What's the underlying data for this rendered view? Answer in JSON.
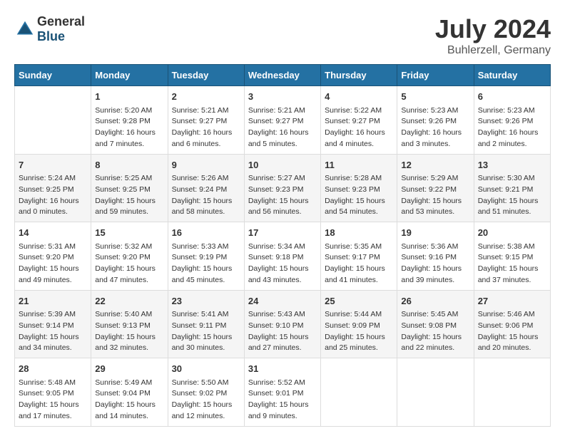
{
  "header": {
    "logo_general": "General",
    "logo_blue": "Blue",
    "month": "July 2024",
    "location": "Buhlerzell, Germany"
  },
  "weekdays": [
    "Sunday",
    "Monday",
    "Tuesday",
    "Wednesday",
    "Thursday",
    "Friday",
    "Saturday"
  ],
  "weeks": [
    [
      {
        "day": "",
        "content": ""
      },
      {
        "day": "1",
        "content": "Sunrise: 5:20 AM\nSunset: 9:28 PM\nDaylight: 16 hours\nand 7 minutes."
      },
      {
        "day": "2",
        "content": "Sunrise: 5:21 AM\nSunset: 9:27 PM\nDaylight: 16 hours\nand 6 minutes."
      },
      {
        "day": "3",
        "content": "Sunrise: 5:21 AM\nSunset: 9:27 PM\nDaylight: 16 hours\nand 5 minutes."
      },
      {
        "day": "4",
        "content": "Sunrise: 5:22 AM\nSunset: 9:27 PM\nDaylight: 16 hours\nand 4 minutes."
      },
      {
        "day": "5",
        "content": "Sunrise: 5:23 AM\nSunset: 9:26 PM\nDaylight: 16 hours\nand 3 minutes."
      },
      {
        "day": "6",
        "content": "Sunrise: 5:23 AM\nSunset: 9:26 PM\nDaylight: 16 hours\nand 2 minutes."
      }
    ],
    [
      {
        "day": "7",
        "content": "Sunrise: 5:24 AM\nSunset: 9:25 PM\nDaylight: 16 hours\nand 0 minutes."
      },
      {
        "day": "8",
        "content": "Sunrise: 5:25 AM\nSunset: 9:25 PM\nDaylight: 15 hours\nand 59 minutes."
      },
      {
        "day": "9",
        "content": "Sunrise: 5:26 AM\nSunset: 9:24 PM\nDaylight: 15 hours\nand 58 minutes."
      },
      {
        "day": "10",
        "content": "Sunrise: 5:27 AM\nSunset: 9:23 PM\nDaylight: 15 hours\nand 56 minutes."
      },
      {
        "day": "11",
        "content": "Sunrise: 5:28 AM\nSunset: 9:23 PM\nDaylight: 15 hours\nand 54 minutes."
      },
      {
        "day": "12",
        "content": "Sunrise: 5:29 AM\nSunset: 9:22 PM\nDaylight: 15 hours\nand 53 minutes."
      },
      {
        "day": "13",
        "content": "Sunrise: 5:30 AM\nSunset: 9:21 PM\nDaylight: 15 hours\nand 51 minutes."
      }
    ],
    [
      {
        "day": "14",
        "content": "Sunrise: 5:31 AM\nSunset: 9:20 PM\nDaylight: 15 hours\nand 49 minutes."
      },
      {
        "day": "15",
        "content": "Sunrise: 5:32 AM\nSunset: 9:20 PM\nDaylight: 15 hours\nand 47 minutes."
      },
      {
        "day": "16",
        "content": "Sunrise: 5:33 AM\nSunset: 9:19 PM\nDaylight: 15 hours\nand 45 minutes."
      },
      {
        "day": "17",
        "content": "Sunrise: 5:34 AM\nSunset: 9:18 PM\nDaylight: 15 hours\nand 43 minutes."
      },
      {
        "day": "18",
        "content": "Sunrise: 5:35 AM\nSunset: 9:17 PM\nDaylight: 15 hours\nand 41 minutes."
      },
      {
        "day": "19",
        "content": "Sunrise: 5:36 AM\nSunset: 9:16 PM\nDaylight: 15 hours\nand 39 minutes."
      },
      {
        "day": "20",
        "content": "Sunrise: 5:38 AM\nSunset: 9:15 PM\nDaylight: 15 hours\nand 37 minutes."
      }
    ],
    [
      {
        "day": "21",
        "content": "Sunrise: 5:39 AM\nSunset: 9:14 PM\nDaylight: 15 hours\nand 34 minutes."
      },
      {
        "day": "22",
        "content": "Sunrise: 5:40 AM\nSunset: 9:13 PM\nDaylight: 15 hours\nand 32 minutes."
      },
      {
        "day": "23",
        "content": "Sunrise: 5:41 AM\nSunset: 9:11 PM\nDaylight: 15 hours\nand 30 minutes."
      },
      {
        "day": "24",
        "content": "Sunrise: 5:43 AM\nSunset: 9:10 PM\nDaylight: 15 hours\nand 27 minutes."
      },
      {
        "day": "25",
        "content": "Sunrise: 5:44 AM\nSunset: 9:09 PM\nDaylight: 15 hours\nand 25 minutes."
      },
      {
        "day": "26",
        "content": "Sunrise: 5:45 AM\nSunset: 9:08 PM\nDaylight: 15 hours\nand 22 minutes."
      },
      {
        "day": "27",
        "content": "Sunrise: 5:46 AM\nSunset: 9:06 PM\nDaylight: 15 hours\nand 20 minutes."
      }
    ],
    [
      {
        "day": "28",
        "content": "Sunrise: 5:48 AM\nSunset: 9:05 PM\nDaylight: 15 hours\nand 17 minutes."
      },
      {
        "day": "29",
        "content": "Sunrise: 5:49 AM\nSunset: 9:04 PM\nDaylight: 15 hours\nand 14 minutes."
      },
      {
        "day": "30",
        "content": "Sunrise: 5:50 AM\nSunset: 9:02 PM\nDaylight: 15 hours\nand 12 minutes."
      },
      {
        "day": "31",
        "content": "Sunrise: 5:52 AM\nSunset: 9:01 PM\nDaylight: 15 hours\nand 9 minutes."
      },
      {
        "day": "",
        "content": ""
      },
      {
        "day": "",
        "content": ""
      },
      {
        "day": "",
        "content": ""
      }
    ]
  ]
}
